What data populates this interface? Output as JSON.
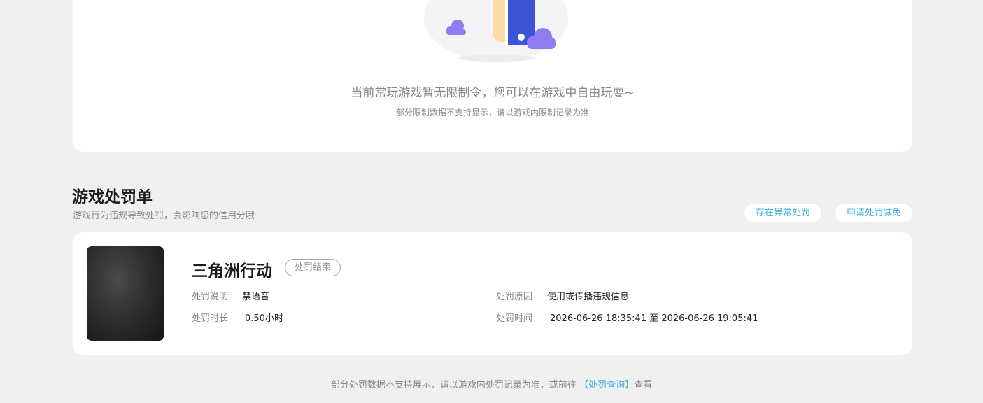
{
  "restriction": {
    "empty_title": "当前常玩游戏暂无限制令，您可以在游戏中自由玩耍~",
    "empty_note": "部分限制数据不支持显示，请以游戏内限制记录为准"
  },
  "penalty_section": {
    "title": "游戏处罚单",
    "subtitle": "游戏行为违规导致处罚，会影响您的信用分哦",
    "abnormal_button": "存在异常处罚",
    "apply_button": "申请处罚减免"
  },
  "record": {
    "game_name": "三角洲行动",
    "status": "处罚结束",
    "desc_label": "处罚说明",
    "desc_value": "禁语音",
    "duration_label": "处罚时长",
    "duration_value": "0.50小时",
    "reason_label": "处罚原因",
    "reason_value": "使用或传播违规信息",
    "time_label": "处罚时间",
    "time_value": "2026-06-26 18:35:41 至 2026-06-26 19:05:41"
  },
  "footer": {
    "note_before": "部分处罚数据不支持展示，请以游戏内处罚记录为准，或前往",
    "link": "【处罚查询】",
    "note_after": "查看"
  },
  "colors": {
    "accent": "#3fb1df",
    "illustration_blue": "#3b55d6",
    "cloud_purple": "#8f7cf0"
  },
  "icons": [
    "hand-phone-illustration",
    "cloud-icon"
  ]
}
